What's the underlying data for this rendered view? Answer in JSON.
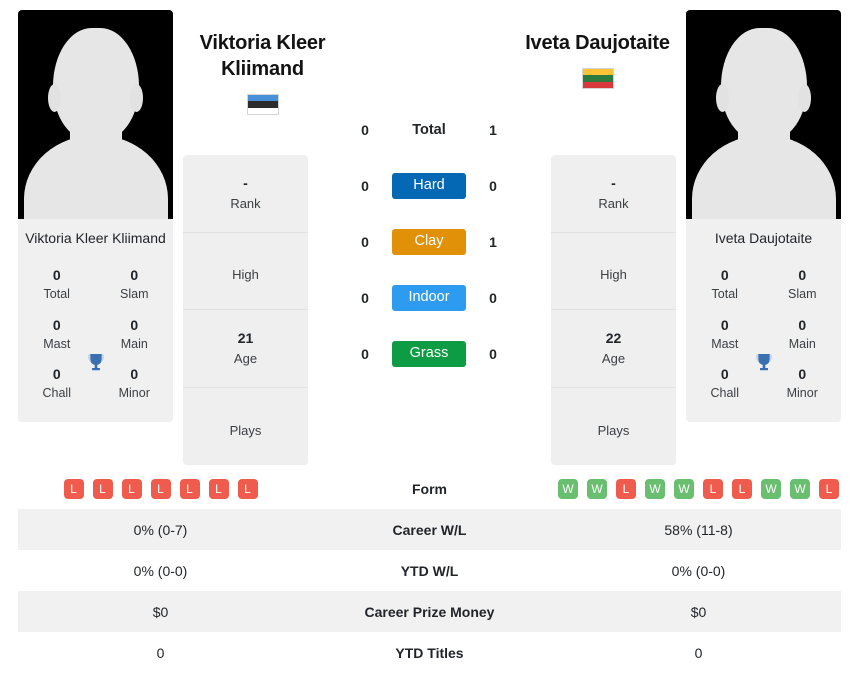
{
  "players": {
    "left": {
      "name": "Viktoria Kleer Kliimand",
      "card_name": "Viktoria Kleer Kliimand",
      "avatar": "player-silhouette-photo",
      "flag": {
        "name": "estonia-flag",
        "stripes": [
          "#4891d9",
          "#2c2c2c",
          "#ffffff"
        ]
      },
      "trophies": [
        {
          "value": "0",
          "label": "Total"
        },
        {
          "value": "0",
          "label": "Slam"
        },
        {
          "value": "0",
          "label": "Mast"
        },
        {
          "value": "0",
          "label": "Main"
        },
        {
          "value": "0",
          "label": "Chall"
        },
        {
          "value": "0",
          "label": "Minor"
        }
      ],
      "info": [
        {
          "value": "-",
          "label": "Rank"
        },
        {
          "value": "",
          "label": "High"
        },
        {
          "value": "21",
          "label": "Age"
        },
        {
          "value": "",
          "label": "Plays"
        }
      ],
      "form": [
        "L",
        "L",
        "L",
        "L",
        "L",
        "L",
        "L"
      ],
      "career_wl": "0% (0-7)",
      "ytd_wl": "0% (0-0)",
      "career_prize_money": "$0",
      "ytd_titles": "0",
      "surface_wins": {
        "total": "0",
        "hard": "0",
        "clay": "0",
        "indoor": "0",
        "grass": "0"
      }
    },
    "right": {
      "name": "Iveta Daujotaite",
      "card_name": "Iveta Daujotaite",
      "avatar": "player-silhouette-photo",
      "flag": {
        "name": "lithuania-flag",
        "stripes": [
          "#fdc337",
          "#2d7a3f",
          "#d9383c"
        ]
      },
      "trophies": [
        {
          "value": "0",
          "label": "Total"
        },
        {
          "value": "0",
          "label": "Slam"
        },
        {
          "value": "0",
          "label": "Mast"
        },
        {
          "value": "0",
          "label": "Main"
        },
        {
          "value": "0",
          "label": "Chall"
        },
        {
          "value": "0",
          "label": "Minor"
        }
      ],
      "info": [
        {
          "value": "-",
          "label": "Rank"
        },
        {
          "value": "",
          "label": "High"
        },
        {
          "value": "22",
          "label": "Age"
        },
        {
          "value": "",
          "label": "Plays"
        }
      ],
      "form": [
        "W",
        "W",
        "L",
        "W",
        "W",
        "L",
        "L",
        "W",
        "W",
        "L"
      ],
      "career_wl": "58% (11-8)",
      "ytd_wl": "0% (0-0)",
      "career_prize_money": "$0",
      "ytd_titles": "0",
      "surface_wins": {
        "total": "1",
        "hard": "0",
        "clay": "1",
        "indoor": "0",
        "grass": "0"
      }
    }
  },
  "surfaces": [
    {
      "key": "total",
      "label": "Total",
      "type": "text",
      "color": ""
    },
    {
      "key": "hard",
      "label": "Hard",
      "type": "pill",
      "color": "#0568b4"
    },
    {
      "key": "clay",
      "label": "Clay",
      "type": "pill",
      "color": "#e09108"
    },
    {
      "key": "indoor",
      "label": "Indoor",
      "type": "pill",
      "color": "#2d9cf0"
    },
    {
      "key": "grass",
      "label": "Grass",
      "type": "pill",
      "color": "#0d9b43"
    }
  ],
  "stats_rows": [
    {
      "label": "Form",
      "type": "form"
    },
    {
      "label": "Career W/L",
      "type": "text",
      "key": "career_wl"
    },
    {
      "label": "YTD W/L",
      "type": "text",
      "key": "ytd_wl"
    },
    {
      "label": "Career Prize Money",
      "type": "text",
      "key": "career_prize_money"
    },
    {
      "label": "YTD Titles",
      "type": "text",
      "key": "ytd_titles"
    }
  ],
  "labels": {
    "form": "Form",
    "career_wl": "Career W/L",
    "ytd_wl": "YTD W/L",
    "career_prize_money": "Career Prize Money",
    "ytd_titles": "YTD Titles"
  },
  "colors": {
    "win_badge": "#69bf6f",
    "loss_badge": "#ef5b4c",
    "trophy_icon": "#3a6fb0",
    "panel_bg": "#f0f0f0",
    "row_alt_bg": "#f1f1f1"
  },
  "icons": {
    "trophy": "trophy-icon"
  }
}
